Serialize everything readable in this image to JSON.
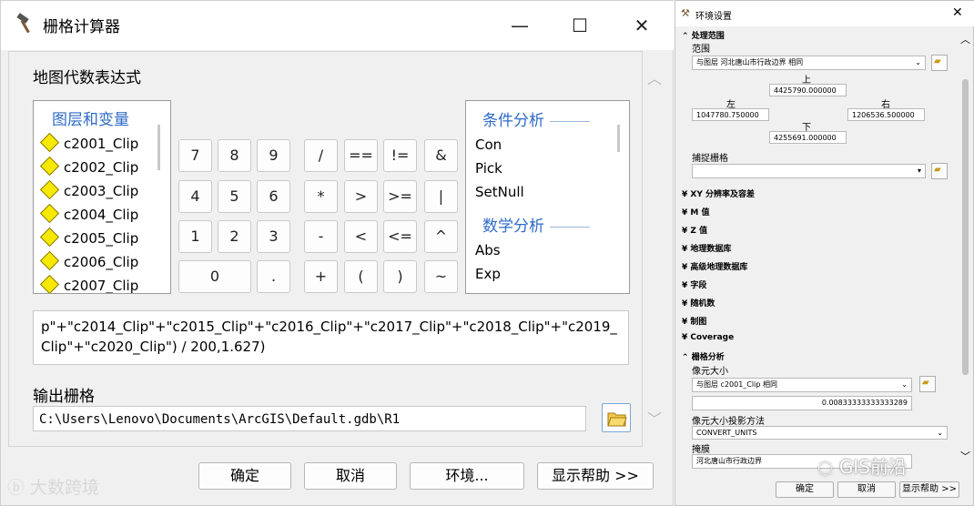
{
  "calc": {
    "title": "栅格计算器",
    "map_algebra_label": "地图代数表达式",
    "layers_header": "图层和变量",
    "layers": [
      "c2001_Clip",
      "c2002_Clip",
      "c2003_Clip",
      "c2004_Clip",
      "c2005_Clip",
      "c2006_Clip",
      "c2007_Clip"
    ],
    "keypad": [
      [
        "7",
        "8",
        "9",
        "/",
        "==",
        "!=",
        "&"
      ],
      [
        "4",
        "5",
        "6",
        "*",
        ">",
        ">=",
        "|"
      ],
      [
        "1",
        "2",
        "3",
        "-",
        "<",
        "<=",
        "^"
      ],
      [
        "0",
        ".",
        "+",
        "(",
        ")",
        "~"
      ]
    ],
    "cond_header": "条件分析",
    "cond_items": [
      "Con",
      "Pick",
      "SetNull"
    ],
    "math_header": "数学分析",
    "math_items": [
      "Abs",
      "Exp"
    ],
    "expression": "p\"+\"c2014_Clip\"+\"c2015_Clip\"+\"c2016_Clip\"+\"c2017_Clip\"+\"c2018_Clip\"+\"c2019_Clip\"+\"c2020_Clip\") / 200,1.627)",
    "output_label": "输出栅格",
    "output_value": "C:\\Users\\Lenovo\\Documents\\ArcGIS\\Default.gdb\\R1",
    "buttons": {
      "ok": "确定",
      "cancel": "取消",
      "env": "环境...",
      "help": "显示帮助 >>"
    },
    "window_buttons": {
      "minimize": "—",
      "maximize": "☐",
      "close": "✕"
    }
  },
  "env": {
    "title": "环境设置",
    "section_processing": "处理范围",
    "extent_label": "范围",
    "extent_value": "与图层 河北唐山市行政边界 相同",
    "top_label": "上",
    "top_value": "4425790.000000",
    "left_label": "左",
    "left_value": "1047780.750000",
    "right_label": "右",
    "right_value": "1206536.500000",
    "bottom_label": "下",
    "bottom_value": "4255691.000000",
    "snap_label": "捕捉栅格",
    "collapsed_sections": [
      "XY 分辨率及容差",
      "M 值",
      "Z 值",
      "地理数据库",
      "高级地理数据库",
      "字段",
      "随机数",
      "制图",
      "Coverage"
    ],
    "section_raster": "栅格分析",
    "cell_size_label": "像元大小",
    "cell_size_value": "与图层 c2001_Clip 相同",
    "cell_size_number": "0.00833333333333289",
    "projection_label": "像元大小投影方法",
    "projection_value": "CONVERT_UNITS",
    "mask_label": "掩膜",
    "mask_value": "河北唐山市行政边界",
    "ok": "确定",
    "cancel": "取消",
    "help": "显示帮助 >>"
  },
  "watermarks": {
    "left": "大数跨境",
    "right": "GIS前沿"
  }
}
